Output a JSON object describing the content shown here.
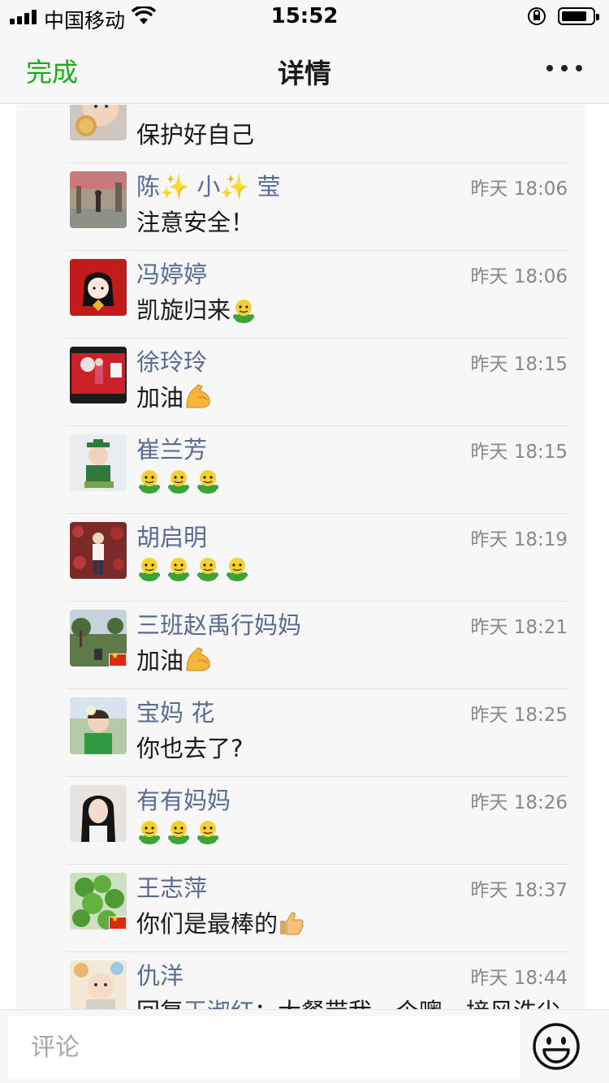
{
  "status_bar": {
    "carrier": "中国移动",
    "time": "15:52"
  },
  "nav": {
    "done_label": "完成",
    "title": "详情"
  },
  "comments": [
    {
      "name": "",
      "time": "",
      "text": "保护好自己",
      "emoji": [],
      "avatar": "baby-eating",
      "flag": false
    },
    {
      "name": "陈✨ 小✨ 莹",
      "time": "昨天 18:06",
      "text": "注意安全！",
      "emoji": [],
      "avatar": "street-photo",
      "flag": false
    },
    {
      "name": "冯婷婷",
      "time": "昨天 18:06",
      "text": "凯旋归来",
      "emoji": [
        "green-creature"
      ],
      "avatar": "red-girl-drawing",
      "flag": false
    },
    {
      "name": "徐玲玲",
      "time": "昨天 18:15",
      "text": "加油",
      "emoji": [
        "flexed-bicep"
      ],
      "avatar": "red-stage",
      "flag": false
    },
    {
      "name": "崔兰芳",
      "time": "昨天 18:15",
      "text": "",
      "emoji": [
        "green-creature",
        "green-creature",
        "green-creature"
      ],
      "avatar": "graduate-child",
      "flag": false
    },
    {
      "name": "胡启明",
      "time": "昨天 18:19",
      "text": "",
      "emoji": [
        "green-creature",
        "green-creature",
        "green-creature",
        "green-creature"
      ],
      "avatar": "flower-wall",
      "flag": false
    },
    {
      "name": "三班赵禹行妈妈",
      "time": "昨天 18:21",
      "text": "加油",
      "emoji": [
        "flexed-bicep"
      ],
      "avatar": "park-scene",
      "flag": true
    },
    {
      "name": "宝妈 花",
      "time": "昨天 18:25",
      "text": "你也去了?",
      "emoji": [],
      "avatar": "child-green",
      "flag": false
    },
    {
      "name": "有有妈妈",
      "time": "昨天 18:26",
      "text": "",
      "emoji": [
        "green-creature",
        "green-creature",
        "green-creature"
      ],
      "avatar": "woman-portrait",
      "flag": false
    },
    {
      "name": "王志萍",
      "time": "昨天 18:37",
      "text": "你们是最棒的",
      "emoji": [
        "thumbs-up"
      ],
      "avatar": "clover",
      "flag": true
    },
    {
      "name": "仇洋",
      "time": "昨天 18:44",
      "text": "回复",
      "mention": "王淑红",
      "text_after": "：大餐带我一个噢，接风洗尘",
      "emoji": [],
      "avatar": "baby-cartoon",
      "flag": false
    }
  ],
  "input": {
    "placeholder": "评论"
  },
  "icons": {
    "emoji_button": "smiley-face-icon",
    "more": "more-dots-icon"
  },
  "colors": {
    "accent_green": "#1aad19",
    "name_blue": "#576b95",
    "time_gray": "#888888"
  }
}
